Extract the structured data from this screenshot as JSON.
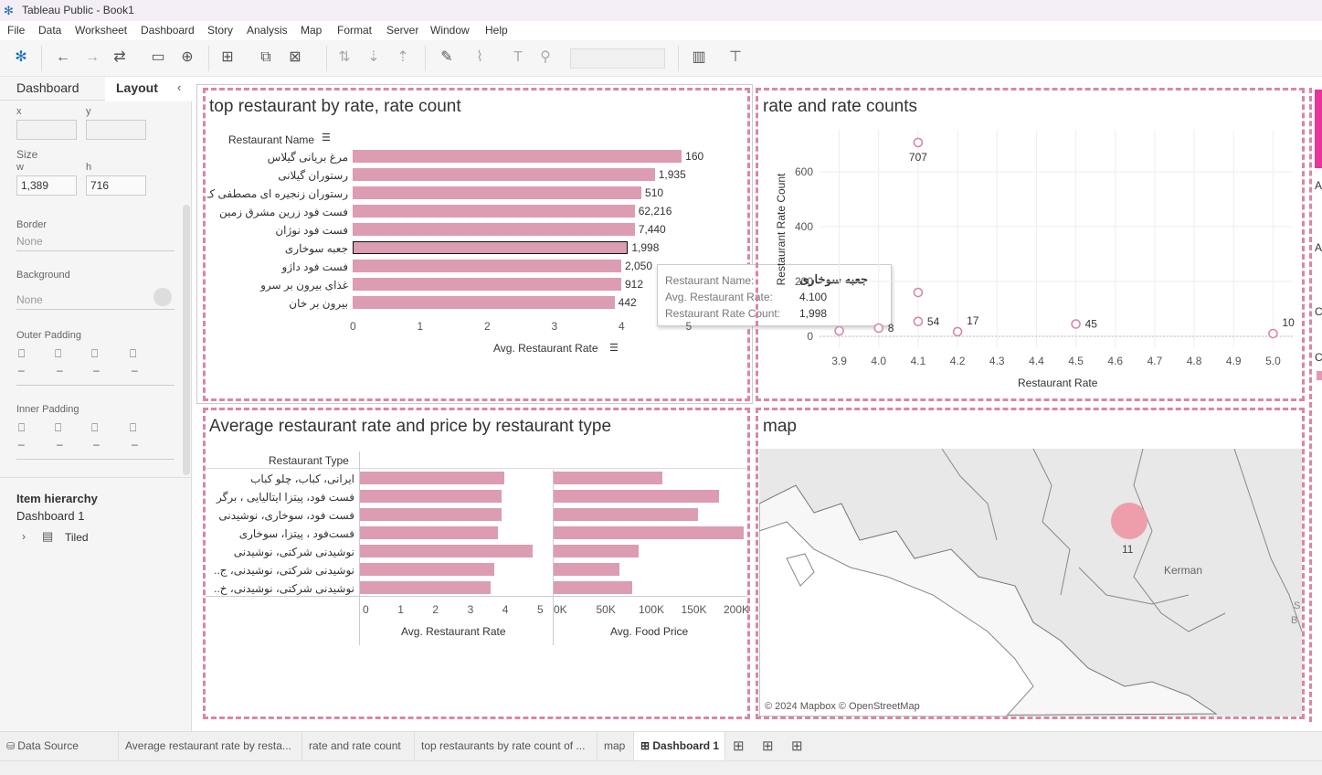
{
  "window": {
    "title": "Tableau Public - Book1"
  },
  "menu": [
    "File",
    "Data",
    "Worksheet",
    "Dashboard",
    "Story",
    "Analysis",
    "Map",
    "Format",
    "Server",
    "Window",
    "Help"
  ],
  "left_panel": {
    "tab_dashboard": "Dashboard",
    "tab_layout": "Layout",
    "x_label": "x",
    "y_label": "y",
    "size_label": "Size",
    "w_label": "w",
    "h_label": "h",
    "w_value": "1,389",
    "h_value": "716",
    "border_label": "Border",
    "border_value": "None",
    "background_label": "Background",
    "background_value": "None",
    "outer_padding_label": "Outer Padding",
    "inner_padding_label": "Inner Padding",
    "hierarchy_title": "Item hierarchy",
    "hierarchy_root": "Dashboard 1",
    "hierarchy_child": "Tiled"
  },
  "sheet1": {
    "title": "top restaurant by rate, rate count",
    "row_header": "Restaurant Name",
    "x_axis_label": "Avg. Restaurant Rate",
    "ticks": [
      "0",
      "1",
      "2",
      "3",
      "4",
      "5"
    ],
    "tooltip": {
      "name_label": "Restaurant Name:",
      "name_value": "جعبه سوخاری",
      "rate_label": "Avg. Restaurant Rate:",
      "rate_value": "4.100",
      "count_label": "Restaurant Rate Count:",
      "count_value": "1,998"
    }
  },
  "sheet2": {
    "title": "rate and rate counts",
    "x_axis_label": "Restaurant Rate",
    "y_axis_label": "Restaurant Rate Count"
  },
  "sheet3": {
    "title": "Average restaurant rate and price by restaurant type",
    "row_header": "Restaurant Type",
    "axis1_label": "Avg. Restaurant Rate",
    "axis2_label": "Avg. Food Price",
    "ticks1": [
      "0",
      "1",
      "2",
      "3",
      "4",
      "5"
    ],
    "ticks2": [
      "0K",
      "50K",
      "100K",
      "150K",
      "200K"
    ]
  },
  "sheet4": {
    "title": "map",
    "city_label": "Kerman",
    "bubble_label": "11",
    "attribution": "© 2024 Mapbox © OpenStreetMap",
    "edge_letters": [
      "S",
      "B"
    ]
  },
  "legend_letters": [
    "A",
    "A",
    "Ci",
    "Ci"
  ],
  "sheet_tabs": [
    "Data Source",
    "Average restaurant rate by resta...",
    "rate and rate count",
    "top restaurants by rate count of ...",
    "map",
    "Dashboard 1"
  ],
  "colors": {
    "bar": "#dc9cb1",
    "zone_border": "#d987a6",
    "accent": "#e8359a"
  },
  "chart_data": [
    {
      "type": "bar",
      "orientation": "horizontal",
      "title": "top restaurant by rate, rate count",
      "categories": [
        "مرغ بریانی گیلاس",
        "رستوران گیلانی",
        "رستوران زنجیره ای مصطفی ک..",
        "فست فود زرین مشرق زمین",
        "فست فود نوژان",
        "جعبه سوخاری",
        "فست فود داژو",
        "غذای بیرون بر سرو",
        "بیرون بر خان"
      ],
      "values": [
        4.9,
        4.5,
        4.3,
        4.2,
        4.2,
        4.1,
        4.0,
        4.0,
        3.9
      ],
      "labels": [
        "160",
        "1,935",
        "510",
        "62,216",
        "7,440",
        "1,998",
        "2,050",
        "912",
        "442"
      ],
      "xlabel": "Avg. Restaurant Rate",
      "xlim": [
        0,
        5
      ],
      "highlighted_index": 5
    },
    {
      "type": "scatter",
      "title": "rate and rate counts",
      "points": [
        {
          "x": 3.9,
          "y": 20,
          "label": ""
        },
        {
          "x": 4.0,
          "y": 30,
          "label": "8"
        },
        {
          "x": 4.1,
          "y": 707,
          "label": "707"
        },
        {
          "x": 4.1,
          "y": 160,
          "label": ""
        },
        {
          "x": 4.1,
          "y": 54,
          "label": "54"
        },
        {
          "x": 4.2,
          "y": 17,
          "label": "17"
        },
        {
          "x": 4.5,
          "y": 45,
          "label": "45"
        },
        {
          "x": 5.0,
          "y": 10,
          "label": "10"
        }
      ],
      "x_ticks": [
        "3.9",
        "4.0",
        "4.1",
        "4.2",
        "4.3",
        "4.4",
        "4.5",
        "4.6",
        "4.7",
        "4.8",
        "4.9",
        "5.0"
      ],
      "y_ticks": [
        "0",
        "200",
        "400",
        "600"
      ],
      "xlabel": "Restaurant Rate",
      "ylabel": "Restaurant Rate Count",
      "xlim": [
        3.85,
        5.05
      ],
      "ylim": [
        0,
        740
      ]
    },
    {
      "type": "bar",
      "orientation": "horizontal",
      "title": "Average restaurant rate and price by restaurant type",
      "categories": [
        "ایرانی، کباب، چلو کباب",
        "فست فود، پیتزا ایتالیایی ، برگر",
        "فست فود، سوخاری، نوشیدنی",
        "فست‌فود ، پیتزا، سوخاری",
        "نوشیدنی شرکتی، نوشیدنی",
        "نوشیدنی شرکتی، نوشیدنی، ج..",
        "نوشیدنی شرکتی، نوشیدنی، خ.."
      ],
      "series": [
        {
          "name": "Avg. Restaurant Rate",
          "values": [
            4.1,
            4.0,
            4.0,
            3.9,
            4.9,
            3.8,
            3.7
          ],
          "xlim": [
            0,
            5.2
          ]
        },
        {
          "name": "Avg. Food Price",
          "values": [
            125000,
            190000,
            165000,
            218000,
            97000,
            75000,
            90000
          ],
          "xlim": [
            0,
            220000
          ]
        }
      ]
    }
  ]
}
